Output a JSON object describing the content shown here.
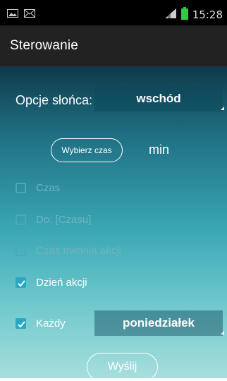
{
  "status_bar": {
    "time": "15:28",
    "icons": [
      "image-icon",
      "mail-icon",
      "signal-icon",
      "battery-icon"
    ],
    "battery_color": "#2ecc40"
  },
  "action_bar": {
    "title": "Sterowanie"
  },
  "sun": {
    "label": "Opcje słońca:",
    "selected": "wschód"
  },
  "time_picker": {
    "button_label": "Wybierz czas",
    "unit": "min"
  },
  "options": [
    {
      "label": "Czas",
      "checked": false
    },
    {
      "label": "Do: [Czasu]",
      "checked": false
    },
    {
      "label": "Czas trwania akcji",
      "checked": false
    },
    {
      "label": "Dzień akcji",
      "checked": true
    },
    {
      "label": "Każdy",
      "checked": true
    }
  ],
  "day_spinner": {
    "selected": "poniedziałek"
  },
  "send_button": {
    "label": "Wyślij"
  },
  "colors": {
    "accent": "#27a9c3",
    "background_top": "#0e3a4a",
    "background_bottom": "#a7dedd"
  }
}
